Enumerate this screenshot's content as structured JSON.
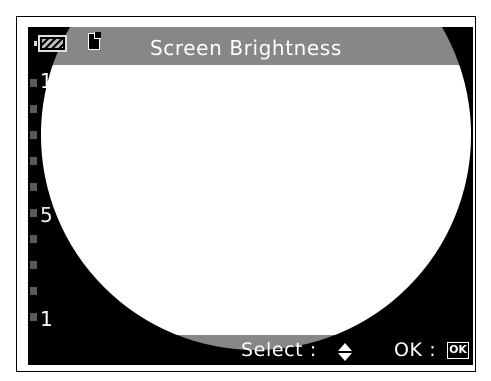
{
  "header": {
    "title": "Screen Brightness",
    "battery_icon": "battery-icon",
    "card_icon": "memory-card-icon"
  },
  "brightness": {
    "scale_max_label": "10",
    "scale_mid_label": "5",
    "scale_min_label": "1",
    "max": 10,
    "min": 1
  },
  "footer": {
    "select_label": "Select :",
    "select_icon": "up-down-arrow-icon",
    "ok_label": "OK :",
    "ok_badge": "OK"
  },
  "colors": {
    "screen_bg": "#000000",
    "gray_circle": "#878787",
    "display_white": "#ffffff",
    "text": "#ffffff"
  }
}
